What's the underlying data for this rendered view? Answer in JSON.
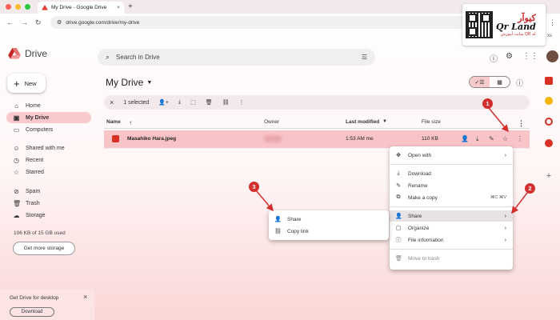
{
  "browser": {
    "tab_title": "My Drive - Google Drive",
    "new_tab_symbol": "+",
    "url": "drive.google.com/drive/my-drive"
  },
  "watermark": {
    "title_fa": "کیوآر",
    "title_en": "Qr Land",
    "tagline": "سایت آموزش QR کد",
    "extra": "xs"
  },
  "header": {
    "app_name": "Drive",
    "search_placeholder": "Search in Drive"
  },
  "sidebar": {
    "new_label": "New",
    "items": [
      {
        "label": "Home",
        "icon": "home-icon"
      },
      {
        "label": "My Drive",
        "icon": "drive-icon",
        "active": true
      },
      {
        "label": "Computers",
        "icon": "computer-icon"
      },
      {
        "label": "Shared with me",
        "icon": "people-icon"
      },
      {
        "label": "Recent",
        "icon": "clock-icon"
      },
      {
        "label": "Starred",
        "icon": "star-icon"
      },
      {
        "label": "Spam",
        "icon": "spam-icon"
      },
      {
        "label": "Trash",
        "icon": "trash-icon"
      },
      {
        "label": "Storage",
        "icon": "cloud-icon"
      }
    ],
    "storage_text": "106 KB of 15 GB used",
    "get_more_label": "Get more storage",
    "promo_title": "Get Drive for desktop",
    "promo_download": "Download"
  },
  "main": {
    "title": "My Drive",
    "selection_count": "1 selected",
    "columns": {
      "name": "Name",
      "owner": "Owner",
      "last_modified": "Last modified",
      "file_size": "File size"
    },
    "file": {
      "name": "Masahiko Hara.jpeg",
      "modified": "1:53 AM me",
      "size": "110 KB"
    }
  },
  "context_menu": {
    "open_with": "Open with",
    "download": "Download",
    "rename": "Rename",
    "make_copy": "Make a copy",
    "make_copy_shortcut": "⌘C ⌘V",
    "share": "Share",
    "organize": "Organize",
    "file_information": "File information",
    "move_to_trash": "Move to trash"
  },
  "share_submenu": {
    "share": "Share",
    "copy_link": "Copy link"
  },
  "annotations": {
    "one": "1",
    "two": "2",
    "three": "3",
    "color": "#d32f2f"
  }
}
